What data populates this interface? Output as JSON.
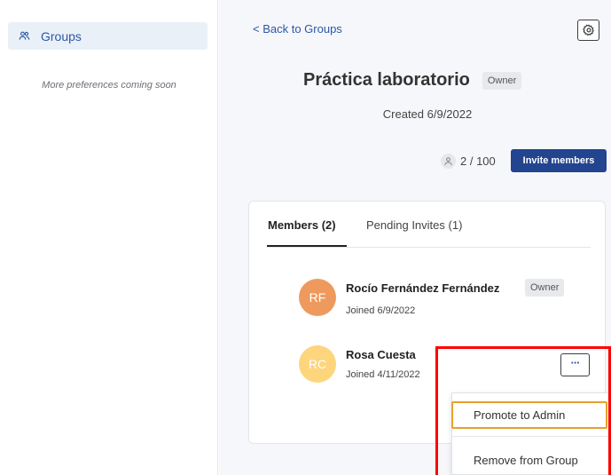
{
  "sidebar": {
    "items": [
      {
        "label": "Groups",
        "icon": "people-icon"
      }
    ],
    "note": "More preferences coming soon"
  },
  "header": {
    "back_label": "< Back to Groups",
    "settings_icon": "gear-icon"
  },
  "group": {
    "title": "Práctica laboratorio",
    "role_badge": "Owner",
    "created": "Created 6/9/2022",
    "member_count": "2 / 100",
    "invite_label": "Invite members"
  },
  "tabs": [
    {
      "label": "Members (2)",
      "active": true
    },
    {
      "label": "Pending Invites (1)",
      "active": false
    }
  ],
  "members": [
    {
      "initials": "RF",
      "name": "Rocío Fernández Fernández",
      "joined": "Joined 6/9/2022",
      "badge": "Owner",
      "avatar_color": "#ee9a5e"
    },
    {
      "initials": "RC",
      "name": "Rosa Cuesta",
      "joined": "Joined 4/11/2022",
      "badge": "",
      "avatar_color": "#fdd57c"
    }
  ],
  "member_actions": {
    "more_label": "···",
    "menu": [
      "Promote to Admin",
      "Remove from Group"
    ]
  },
  "colors": {
    "accent": "#2b57a6",
    "primary_button": "#23448f",
    "focus_outline": "#e6a12a",
    "highlight_box": "#ff0000"
  }
}
